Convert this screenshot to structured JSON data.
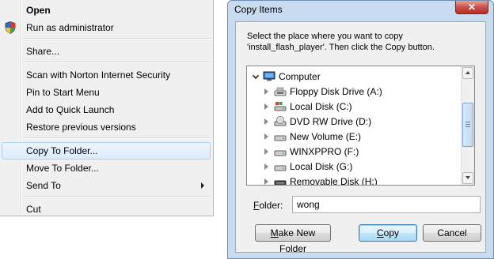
{
  "context_menu": {
    "items": [
      {
        "label": "Open",
        "bold": true
      },
      {
        "label": "Run as administrator"
      },
      {
        "label": "Share..."
      },
      {
        "label": "Scan with Norton Internet Security"
      },
      {
        "label": "Pin to Start Menu"
      },
      {
        "label": "Add to Quick Launch"
      },
      {
        "label": "Restore previous versions"
      },
      {
        "label": "Copy To Folder...",
        "highlighted": true
      },
      {
        "label": "Move To Folder..."
      },
      {
        "label": "Send To",
        "submenu": true
      },
      {
        "label": "Cut"
      }
    ]
  },
  "dialog": {
    "title": "Copy Items",
    "close_label": "✕",
    "instruction": "Select the place where you want to copy 'install_flash_player'. Then click the Copy button.",
    "tree": {
      "root": "Computer",
      "items": [
        {
          "label": "Floppy Disk Drive (A:)",
          "icon": "floppy-drive-icon"
        },
        {
          "label": "Local Disk (C:)",
          "icon": "system-disk-icon"
        },
        {
          "label": "DVD RW Drive (D:)",
          "icon": "dvd-drive-icon"
        },
        {
          "label": "New Volume (E:)",
          "icon": "hard-disk-icon"
        },
        {
          "label": "WINXPPRO (F:)",
          "icon": "hard-disk-icon"
        },
        {
          "label": "Local Disk (G:)",
          "icon": "hard-disk-icon"
        },
        {
          "label": "Removable Disk (H:)",
          "icon": "removable-disk-icon"
        }
      ]
    },
    "folder_label_accel": "F",
    "folder_label_rest": "older:",
    "folder_value": "wong",
    "buttons": {
      "make_new_folder_accel": "M",
      "make_new_folder_rest": "ake New Folder",
      "copy_accel": "C",
      "copy_rest": "opy",
      "cancel": "Cancel"
    }
  },
  "colors": {
    "menu_bg": "#f0f0f0",
    "menu_highlight": "#dcebfc",
    "dialog_frame": "#c9dbee",
    "close_button": "#c75050"
  }
}
